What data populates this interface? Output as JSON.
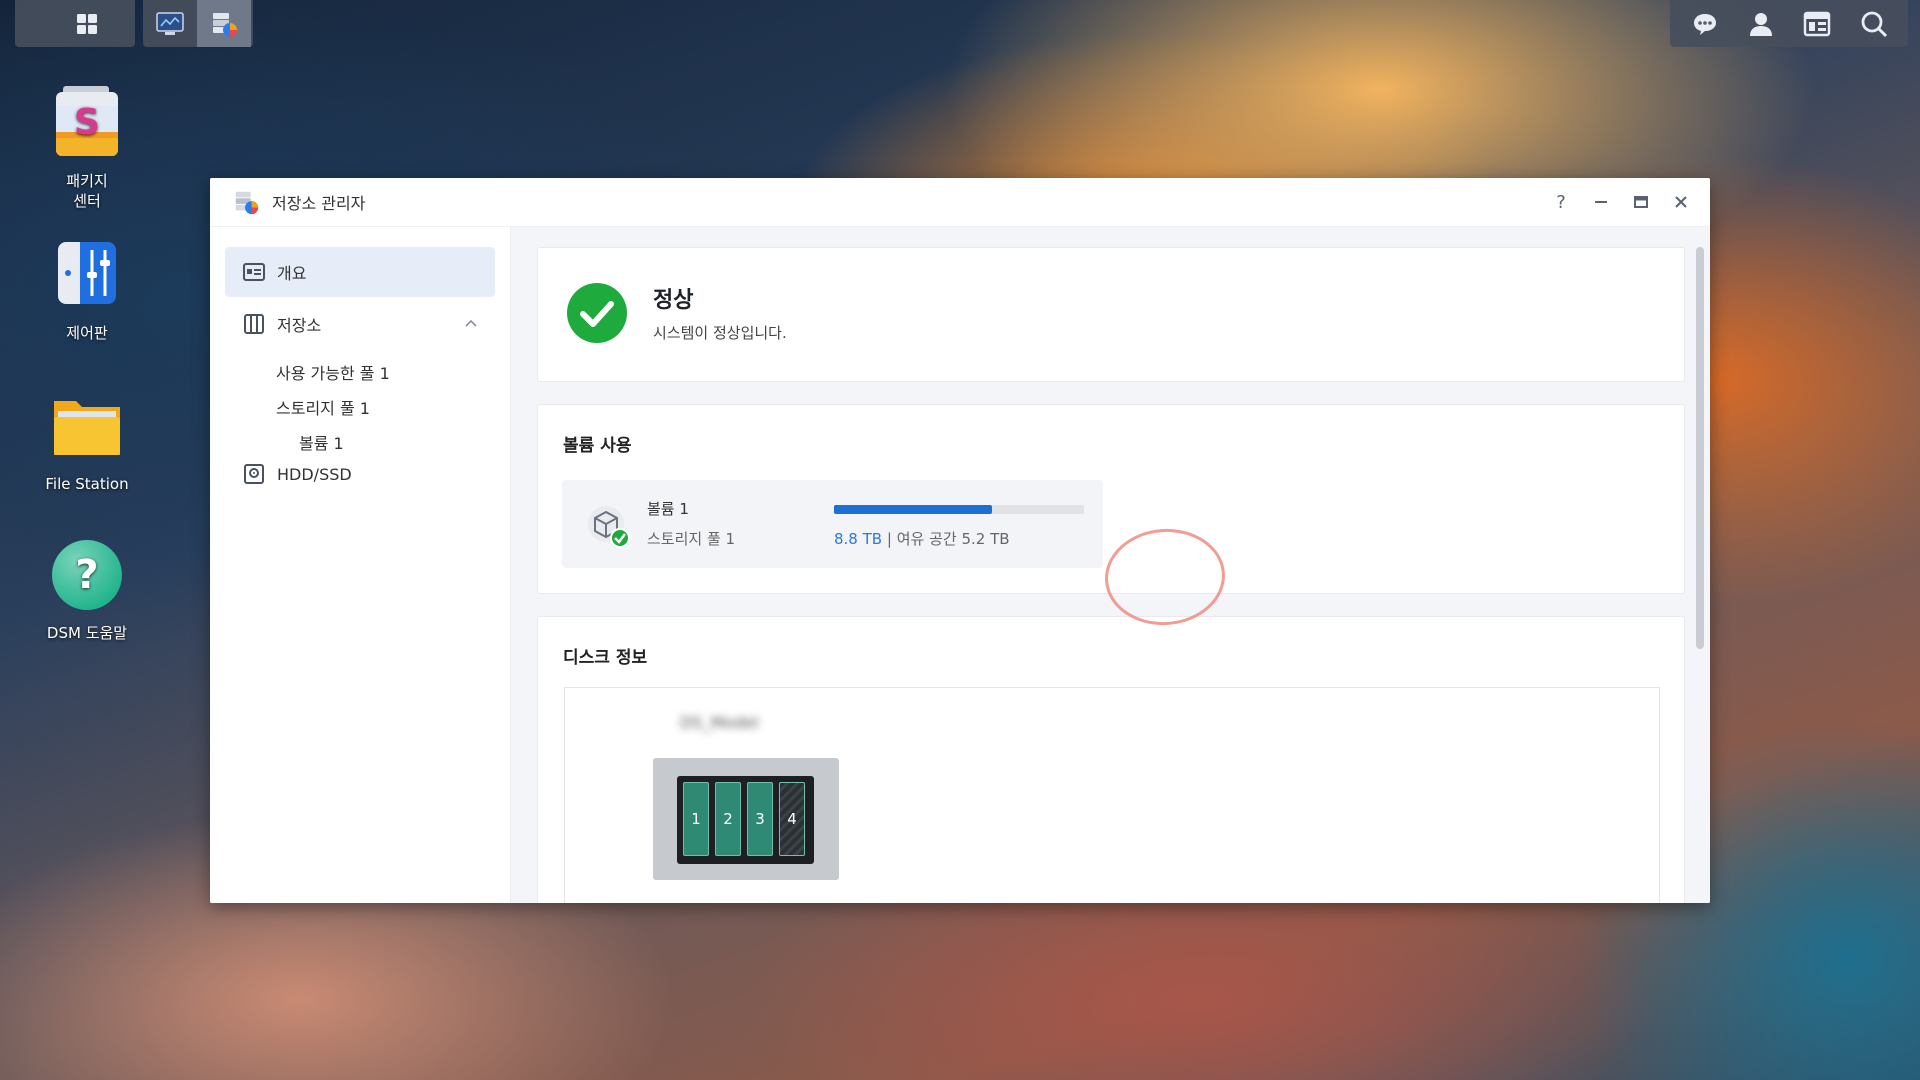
{
  "taskbar": {
    "left_icons": [
      "main-menu-icon"
    ],
    "open_apps": [
      "monitor-icon",
      "storage-manager-icon"
    ],
    "right_icons": [
      "chat-icon",
      "user-icon",
      "widgets-icon",
      "search-icon"
    ]
  },
  "desktop": {
    "icons": [
      {
        "label": "패키지\n센터",
        "icon": "package-center-icon"
      },
      {
        "label": "제어판",
        "icon": "control-panel-icon"
      },
      {
        "label": "File Station",
        "icon": "folder-icon"
      },
      {
        "label": "DSM 도움말",
        "icon": "help-icon"
      }
    ]
  },
  "window": {
    "title": "저장소 관리자",
    "controls": {
      "help": "?"
    }
  },
  "sidebar": {
    "overview": "개요",
    "storage": "저장소",
    "available_pool": "사용 가능한 풀 1",
    "storage_pool": "스토리지 풀 1",
    "volume": "볼륨 1",
    "hdd_ssd": "HDD/SSD"
  },
  "status": {
    "title": "정상",
    "subtitle": "시스템이 정상입니다."
  },
  "volume_usage": {
    "section_title": "볼륨 사용",
    "volume_name": "볼륨 1",
    "pool_name": "스토리지 풀 1",
    "used": "8.8 TB",
    "separator": "|",
    "free": "여유 공간 5.2 TB",
    "used_fraction": 0.63,
    "bar_color": "#1d6fd6"
  },
  "disk_info": {
    "section_title": "디스크 정보",
    "bays": [
      "1",
      "2",
      "3",
      "4"
    ]
  },
  "colors": {
    "accent": "#1d6fd6",
    "healthy": "#1faa3d",
    "annotation": "#ee8c82"
  }
}
